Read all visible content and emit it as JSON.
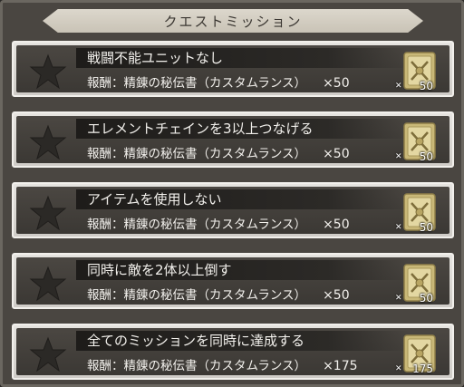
{
  "header": {
    "title": "クエストミッション"
  },
  "missions": [
    {
      "name": "戦闘不能ユニットなし",
      "reward_label": "報酬：精錬の秘伝書（カスタムランス）",
      "reward_qty": "×50",
      "icon_count": "50"
    },
    {
      "name": "エレメントチェインを3以上つなげる",
      "reward_label": "報酬：精錬の秘伝書（カスタムランス）",
      "reward_qty": "×50",
      "icon_count": "50"
    },
    {
      "name": "アイテムを使用しない",
      "reward_label": "報酬：精錬の秘伝書（カスタムランス）",
      "reward_qty": "×50",
      "icon_count": "50"
    },
    {
      "name": "同時に敵を2体以上倒す",
      "reward_label": "報酬：精錬の秘伝書（カスタムランス）",
      "reward_qty": "×50",
      "icon_count": "50"
    },
    {
      "name": "全てのミッションを同時に達成する",
      "reward_label": "報酬：精錬の秘伝書（カスタムランス）",
      "reward_qty": "×175",
      "icon_count": "175"
    }
  ],
  "icons": {
    "mission_status": "star-icon",
    "reward_item": "secret-book-icon"
  },
  "colors": {
    "star_inactive": "#2b2926",
    "book_gold": "#c9b878"
  }
}
